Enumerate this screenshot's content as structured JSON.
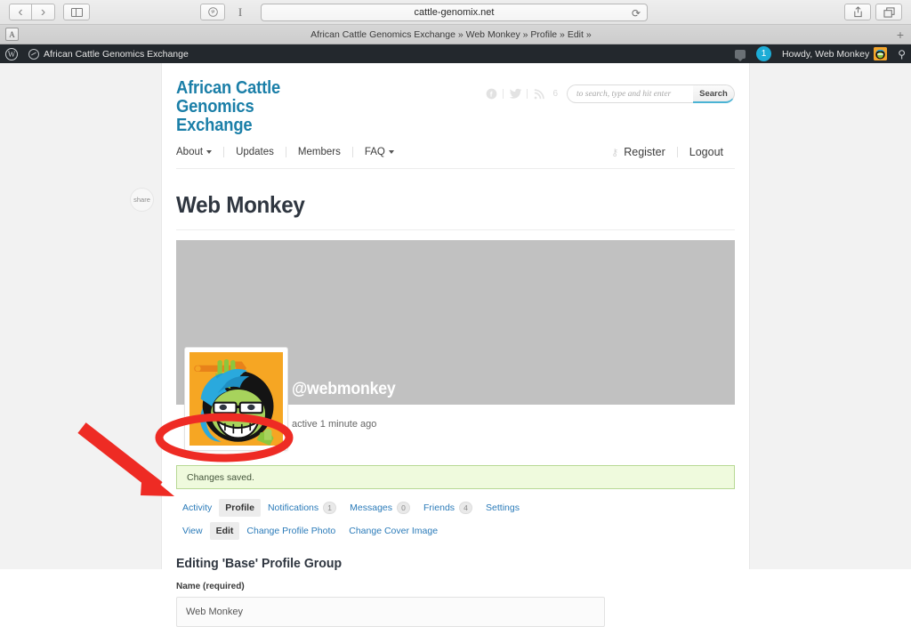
{
  "browser": {
    "url": "cattle-genomix.net",
    "tab_title": "African Cattle Genomics Exchange » Web Monkey » Profile » Edit »",
    "tab_favicon_letter": "A",
    "back_icon": "chevron-left-icon",
    "forward_icon": "chevron-right-icon",
    "sidebar_icon": "sidebar-toggle-icon",
    "pinterest_icon": "pinterest-icon",
    "reader_icon": "reader-cursor-icon",
    "reload_icon": "reload-icon",
    "share_icon": "share-export-icon",
    "tabs_icon": "tab-overview-icon",
    "new_tab_icon": "plus-icon"
  },
  "adminbar": {
    "wp_logo": "wordpress-logo-icon",
    "dashboard_icon": "dashboard-speedometer-icon",
    "site_name": "African Cattle Genomics Exchange",
    "comments_icon": "comment-bubble-icon",
    "notification_count": "1",
    "notification_color": "#1dacd6",
    "howdy": "Howdy, Web Monkey",
    "avatar_icon": "user-avatar-thumb",
    "search_icon": "search-icon"
  },
  "site": {
    "title": "African Cattle Genomics Exchange",
    "title_color": "#1b7fa8",
    "social": [
      {
        "name": "facebook-icon",
        "glyph": "f"
      },
      {
        "name": "twitter-icon",
        "glyph": "✒"
      },
      {
        "name": "rss-icon",
        "glyph": "◔",
        "count": "6"
      }
    ],
    "search": {
      "placeholder": "to search, type and hit enter",
      "value": "",
      "button": "Search",
      "accent": "#4ab3d4"
    },
    "nav": [
      {
        "label": "About",
        "has_caret": true
      },
      {
        "label": "Updates",
        "has_caret": false
      },
      {
        "label": "Members",
        "has_caret": false
      },
      {
        "label": "FAQ",
        "has_caret": true
      }
    ],
    "nav_right": [
      {
        "label": "Register",
        "icon": "key-icon"
      },
      {
        "label": "Logout",
        "icon": ""
      }
    ]
  },
  "share_widget": {
    "label": "share"
  },
  "profile": {
    "page_title": "Web Monkey",
    "cover_color": "#c1c1c1",
    "handle": "@webmonkey",
    "last_active": "active 1 minute ago",
    "avatar_name": "member-avatar"
  },
  "notice": {
    "text": "Changes saved.",
    "bg": "#effadd",
    "border": "#b7d994"
  },
  "tabs": [
    {
      "label": "Activity",
      "count": null,
      "active": false
    },
    {
      "label": "Profile",
      "count": null,
      "active": true
    },
    {
      "label": "Notifications",
      "count": "1",
      "active": false
    },
    {
      "label": "Messages",
      "count": "0",
      "active": false
    },
    {
      "label": "Friends",
      "count": "4",
      "active": false
    },
    {
      "label": "Settings",
      "count": null,
      "active": false
    }
  ],
  "subtabs": [
    {
      "label": "View",
      "active": false
    },
    {
      "label": "Edit",
      "active": true
    },
    {
      "label": "Change Profile Photo",
      "active": false
    },
    {
      "label": "Change Cover Image",
      "active": false
    }
  ],
  "form": {
    "section_title": "Editing 'Base' Profile Group",
    "name_label": "Name (required)",
    "name_value": "Web Monkey",
    "name_placeholder": ""
  },
  "annotation": {
    "color": "#ee2b24",
    "ellipse_name": "red-ellipse-highlight",
    "arrow_name": "red-arrow-pointer"
  }
}
